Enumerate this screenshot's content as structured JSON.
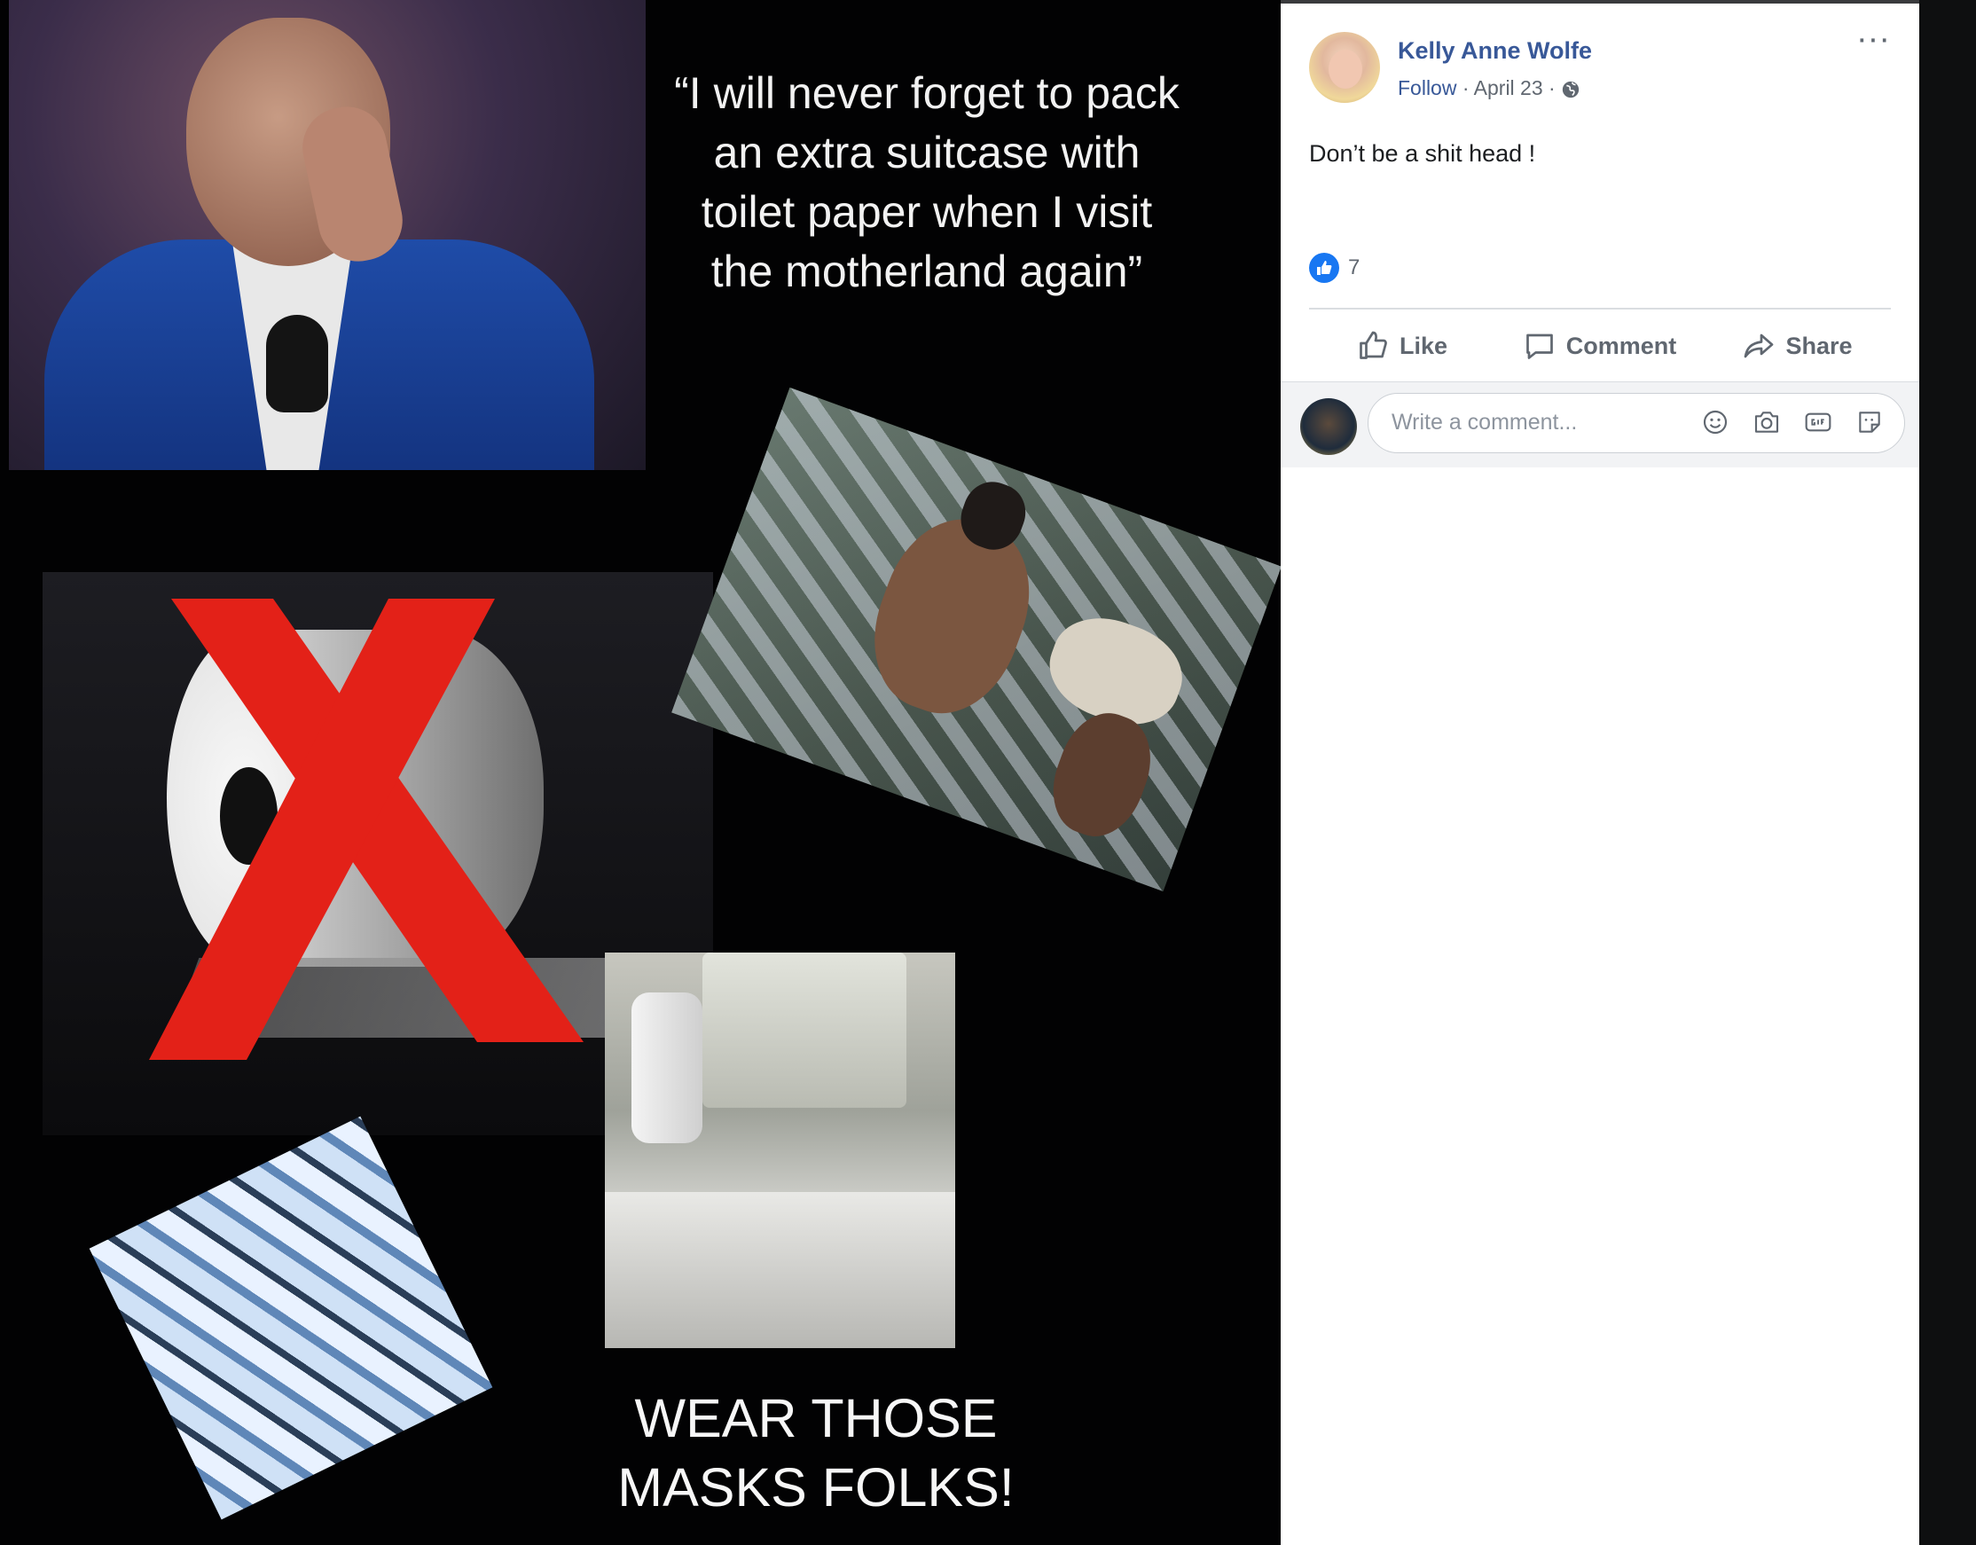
{
  "meme": {
    "quote": "“I will never forget to pack an extra suitcase with toilet paper when I visit the motherland again”",
    "slogan_line1": "WEAR THOSE",
    "slogan_line2": "MASKS FOLKS!"
  },
  "post": {
    "author": "Kelly Anne Wolfe",
    "follow_label": "Follow",
    "date": "April 23",
    "separator": "·",
    "text": "Don’t be a shit head !",
    "reaction_count": "7",
    "like_color": "#1877f2"
  },
  "actions": {
    "like": "Like",
    "comment": "Comment",
    "share": "Share"
  },
  "comment_box": {
    "placeholder": "Write a comment..."
  },
  "icons": {
    "more": "more-options-icon",
    "privacy": "globe-icon",
    "emoji": "emoji-icon",
    "camera": "camera-icon",
    "gif": "gif-icon",
    "sticker": "sticker-icon"
  },
  "colors": {
    "link": "#385898",
    "muted": "#606770",
    "background": "#020203",
    "panel": "#ffffff"
  }
}
